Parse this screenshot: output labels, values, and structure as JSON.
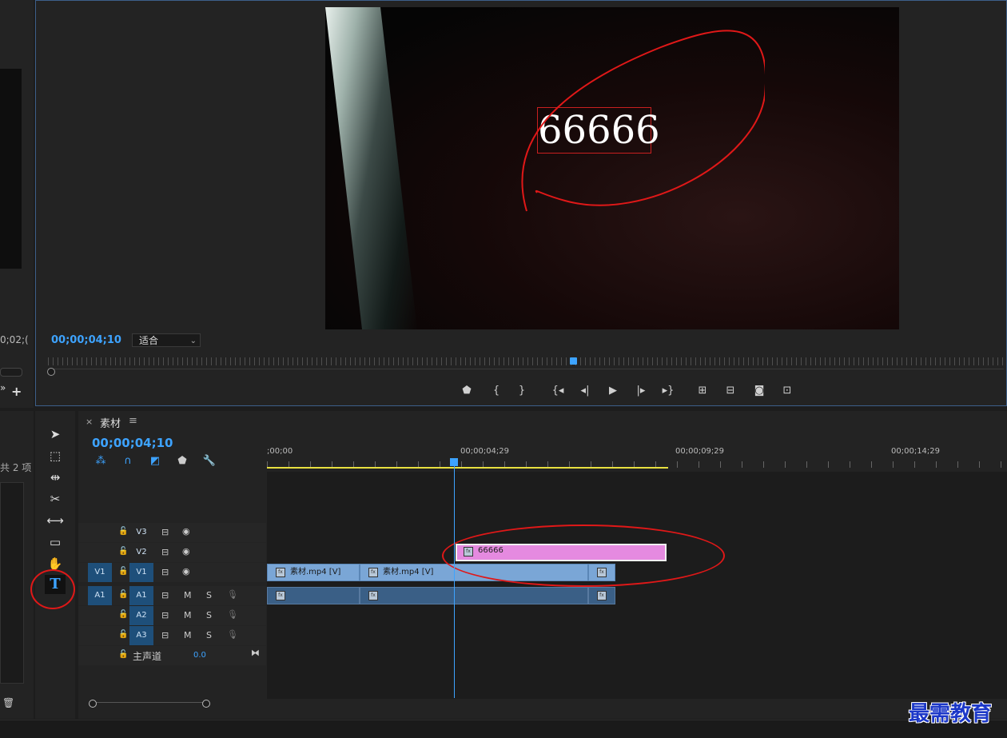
{
  "left_panel": {
    "timecode": "0;02;(",
    "items_count": "共 2 项"
  },
  "program_monitor": {
    "timecode": "00;00;04;10",
    "fit": "适合",
    "overlay_text": "66666"
  },
  "transport_icons": [
    "add-marker-icon",
    "mark-in-icon",
    "mark-out-icon",
    "go-to-in-icon",
    "step-back-icon",
    "play-icon",
    "step-forward-icon",
    "go-to-out-icon",
    "lift-icon",
    "extract-icon",
    "export-frame-icon",
    "button-editor-icon"
  ],
  "timeline": {
    "sequence_name": "素材",
    "timecode": "00;00;04;10",
    "ruler": [
      ";00;00",
      "00;00;04;29",
      "00;00;09;29",
      "00;00;14;29"
    ],
    "tracks": {
      "video": [
        {
          "name": "V3",
          "source": ""
        },
        {
          "name": "V2",
          "source": ""
        },
        {
          "name": "V1",
          "source": "V1"
        }
      ],
      "audio": [
        {
          "name": "A1",
          "source": "A1",
          "m": "M",
          "s": "S"
        },
        {
          "name": "A2",
          "source": "",
          "m": "M",
          "s": "S"
        },
        {
          "name": "A3",
          "source": "",
          "m": "M",
          "s": "S"
        }
      ],
      "master": {
        "label": "主声道",
        "value": "0.0"
      }
    },
    "clips": {
      "title_clip": "66666",
      "video_clip_1": "素材.mp4 [V]",
      "video_clip_2": "素材.mp4 [V]"
    }
  },
  "watermark": "最需教育",
  "colors": {
    "accent": "#3da3ff",
    "title_clip": "#e58ae0",
    "video_clip": "#7aa6d6",
    "annotation": "#e01818",
    "work_area": "#e8e040"
  }
}
